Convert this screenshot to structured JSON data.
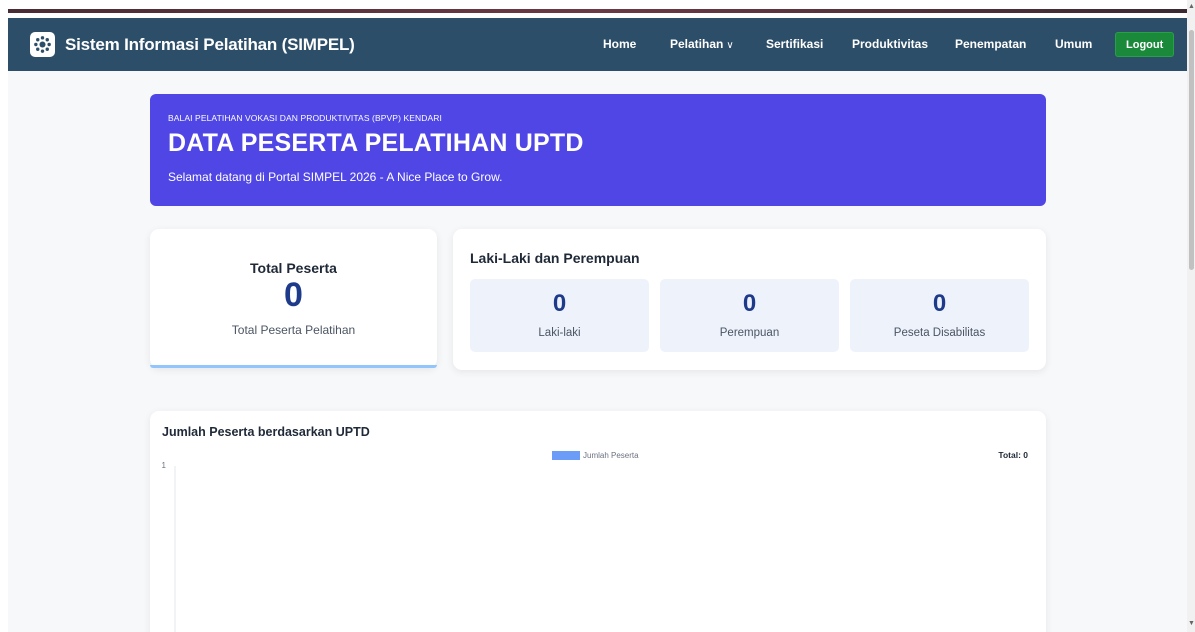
{
  "navbar": {
    "brand_title": "Sistem Informasi Pelatihan (SIMPEL)",
    "brand_icon": "gear-logo-icon",
    "items": [
      {
        "label": "Home"
      },
      {
        "label": "Pelatihan",
        "has_dropdown": true
      },
      {
        "label": "Sertifikasi"
      },
      {
        "label": "Produktivitas"
      },
      {
        "label": "Penempatan"
      },
      {
        "label": "Umum"
      }
    ],
    "logout_label": "Logout",
    "colors": {
      "background": "#2d4e68",
      "logout": "#1a8a3a"
    }
  },
  "hero": {
    "org": "BALAI PELATIHAN VOKASI DAN PRODUKTIVITAS (BPVP) KENDARI",
    "title": "DATA PESERTA PELATIHAN UPTD",
    "subtitle": "Selamat datang di Portal SIMPEL 2026 - A Nice Place to Grow.",
    "color": "#4f46e5"
  },
  "total_card": {
    "label": "Total Peserta",
    "value": "0",
    "sublabel": "Total Peserta Pelatihan"
  },
  "gender_card": {
    "title": "Laki-Laki dan Perempuan",
    "stats": [
      {
        "value": "0",
        "label": "Laki-laki"
      },
      {
        "value": "0",
        "label": "Perempuan"
      },
      {
        "value": "0",
        "label": "Peseta Disabilitas"
      }
    ]
  },
  "chart_card": {
    "title": "Jumlah Peserta berdasarkan UPTD",
    "total_label": "Total: 0"
  },
  "chart_data": {
    "type": "bar",
    "title": "Jumlah Peserta berdasarkan UPTD",
    "categories": [],
    "series": [
      {
        "name": "Jumlah Peserta",
        "values": [],
        "color": "#6b9cf8"
      }
    ],
    "ylim": [
      0,
      1
    ],
    "y_ticks": [
      "1"
    ],
    "legend_position": "top-center",
    "grid": false
  }
}
